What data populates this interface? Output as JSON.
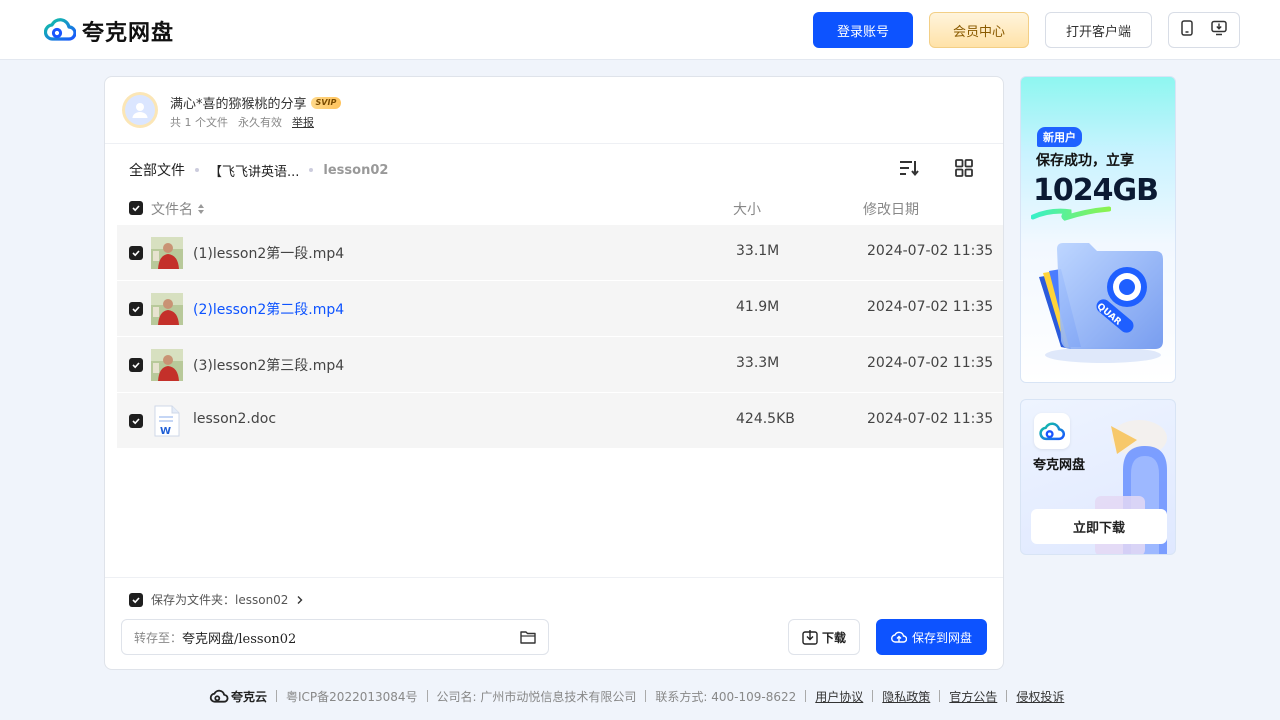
{
  "header": {
    "logo_text": "夸克网盘",
    "login_label": "登录账号",
    "vip_label": "会员中心",
    "client_label": "打开客户端"
  },
  "share": {
    "title": "满心*喜的猕猴桃的分享",
    "badge": "SVIP",
    "file_count": "共 1 个文件",
    "validity": "永久有效",
    "report": "举报"
  },
  "breadcrumb": {
    "root": "全部文件",
    "middle": "【飞飞讲英语...",
    "current": "lesson02"
  },
  "table": {
    "col_name": "文件名",
    "col_size": "大小",
    "col_date": "修改日期",
    "rows": [
      {
        "name": "(1)lesson2第一段.mp4",
        "size": "33.1M",
        "date": "2024-07-02 11:35",
        "type": "video-icon"
      },
      {
        "name": "(2)lesson2第二段.mp4",
        "size": "41.9M",
        "date": "2024-07-02 11:35",
        "type": "video-icon"
      },
      {
        "name": "(3)lesson2第三段.mp4",
        "size": "33.3M",
        "date": "2024-07-02 11:35",
        "type": "video-icon"
      },
      {
        "name": "lesson2.doc",
        "size": "424.5KB",
        "date": "2024-07-02 11:35",
        "type": "word-doc-icon"
      }
    ]
  },
  "bottom": {
    "save_as": "保存为文件夹：lesson02",
    "dest_label": "转存至：",
    "dest_value": "夸克网盘/lesson02",
    "download_label": "下载",
    "save_label": "保存到网盘"
  },
  "ads": {
    "ad1_badge": "新用户",
    "ad1_line": "保存成功，立享",
    "ad1_big": "1024GB",
    "ad2_name": "夸克网盘",
    "ad2_button": "立即下载"
  },
  "footer": {
    "brand": "夸克云",
    "icp": "粤ICP备2022013084号",
    "company": "公司名: 广州市动悦信息技术有限公司",
    "contact": "联系方式: 400-109-8622",
    "links": [
      "用户协议",
      "隐私政策",
      "官方公告",
      "侵权投诉"
    ]
  },
  "colors": {
    "accent": "#0d53ff",
    "vip_bg": "#ffe2a8"
  }
}
